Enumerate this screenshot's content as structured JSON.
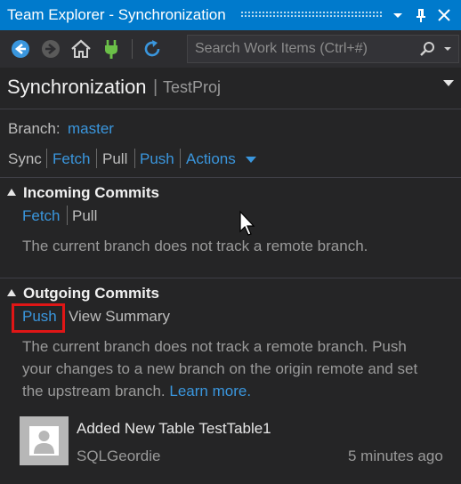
{
  "window": {
    "title": "Team Explorer - Synchronization"
  },
  "titlebar_buttons": {
    "dropdown_icon": "chevron-down-icon",
    "pin_icon": "pin-icon",
    "close_icon": "close-icon"
  },
  "toolbar": {
    "icons": [
      "back-arrow-icon",
      "forward-arrow-icon",
      "home-icon",
      "plug-icon",
      "refresh-icon"
    ],
    "search_placeholder": "Search Work Items (Ctrl+#)"
  },
  "header": {
    "title": "Synchronization",
    "separator": "|",
    "project": "TestProj"
  },
  "branch": {
    "label": "Branch:",
    "value": "master"
  },
  "actions": {
    "sync": "Sync",
    "fetch": "Fetch",
    "pull": "Pull",
    "push": "Push",
    "actions": "Actions"
  },
  "incoming": {
    "title": "Incoming Commits",
    "fetch": "Fetch",
    "pull": "Pull",
    "message": "The current branch does not track a remote branch."
  },
  "outgoing": {
    "title": "Outgoing Commits",
    "push": "Push",
    "view_summary": "View Summary",
    "message_lines": [
      "The current branch does not track a remote branch. Push",
      "your changes to a new branch on the origin remote and set",
      "the upstream branch."
    ],
    "learn_more": "Learn more."
  },
  "commit": {
    "message": "Added New Table TestTable1",
    "author": "SQLGeordie",
    "time": "5 minutes ago"
  },
  "colors": {
    "accent": "#007acc",
    "link": "#3a96dd",
    "highlight": "#e01616",
    "background": "#252526"
  }
}
